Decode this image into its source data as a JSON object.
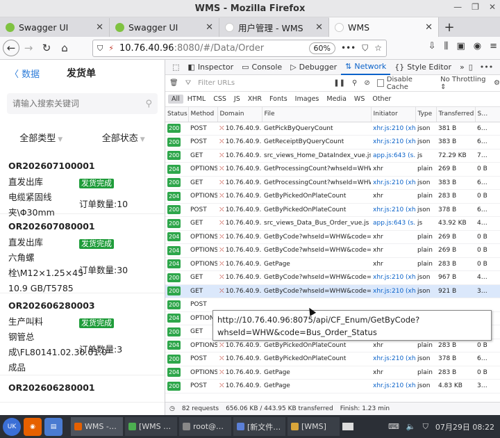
{
  "window": {
    "title": "WMS - Mozilla Firefox"
  },
  "tabs": [
    {
      "label": "Swagger UI",
      "icon_color": "#7fc241"
    },
    {
      "label": "Swagger UI",
      "icon_color": "#7fc241"
    },
    {
      "label": "用户管理 - WMS",
      "icon_color": "#ffffff"
    },
    {
      "label": "WMS",
      "icon_color": "#ffffff"
    }
  ],
  "nav": {
    "url_host": "10.76.40.96",
    "url_rest": ":8080/#/Data/Order",
    "zoom": "60%"
  },
  "page": {
    "back_label": "数据",
    "title": "发货单",
    "search_placeholder": "请输入搜索关键词",
    "filter_type": "全部类型",
    "filter_status": "全部状态",
    "orders": [
      {
        "id": "OR202607100001",
        "type": "直发出库",
        "badge": "发货完成",
        "material_1": "电缆紧固线",
        "material_2": "夹\\Φ30mm",
        "qty": "订单数量:10"
      },
      {
        "id": "OR202607080001",
        "type": "直发出库",
        "badge": "发货完成",
        "material_1": "六角螺",
        "material_2": "栓\\M12×1.25×45",
        "material_3": "10.9 GB/T5785",
        "qty": "订单数量:30"
      },
      {
        "id": "OR202606280003",
        "type": "生产叫料",
        "badge": "发货完成",
        "material_1": "钢管总",
        "material_2": "成\\FL80141.02.30.01.0",
        "material_3": "成品",
        "qty": "订单数量:3"
      },
      {
        "id": "OR202606280001"
      }
    ]
  },
  "devtools": {
    "tabs": [
      "Inspector",
      "Console",
      "Debugger",
      "Network",
      "Style Editor"
    ],
    "active_tab": "Network",
    "filter_placeholder": "Filter URLs",
    "disable_cache": "Disable Cache",
    "throttling": "No Throttling",
    "type_filters": [
      "All",
      "HTML",
      "CSS",
      "JS",
      "XHR",
      "Fonts",
      "Images",
      "Media",
      "WS",
      "Other"
    ],
    "columns": [
      "Status",
      "Method",
      "Domain",
      "File",
      "Initiator",
      "Type",
      "Transferred",
      "S…"
    ],
    "requests": [
      {
        "status": "200",
        "method": "POST",
        "domain": "10.76.40.9…",
        "file": "GetPickByQueryCount",
        "initiator": "xhr.js:210 (xhr)",
        "type": "json",
        "transferred": "381 B",
        "size": "6…"
      },
      {
        "status": "200",
        "method": "POST",
        "domain": "10.76.40.9…",
        "file": "GetReceiptByQueryCount",
        "initiator": "xhr.js:210 (xhr)",
        "type": "json",
        "transferred": "383 B",
        "size": "6…"
      },
      {
        "status": "200",
        "method": "GET",
        "domain": "10.76.40.9…",
        "file": "src_views_Home_DataIndex_vue.js",
        "initiator": "app.js:643 (s…",
        "type": "js",
        "transferred": "72.29 KB",
        "size": "7…"
      },
      {
        "status": "204",
        "method": "OPTIONS",
        "domain": "10.76.40.9…",
        "file": "GetProcessingCount?whseId=WHW",
        "initiator": "xhr",
        "type": "plain",
        "transferred": "269 B",
        "size": "0 B"
      },
      {
        "status": "200",
        "method": "GET",
        "domain": "10.76.40.9…",
        "file": "GetProcessingCount?whseId=WHW",
        "initiator": "xhr.js:210 (xhr)",
        "type": "json",
        "transferred": "383 B",
        "size": "6…"
      },
      {
        "status": "204",
        "method": "OPTIONS",
        "domain": "10.76.40.9…",
        "file": "GetByPickedOnPlateCount",
        "initiator": "xhr",
        "type": "plain",
        "transferred": "283 B",
        "size": "0 B"
      },
      {
        "status": "200",
        "method": "POST",
        "domain": "10.76.40.9…",
        "file": "GetByPickedOnPlateCount",
        "initiator": "xhr.js:210 (xhr)",
        "type": "json",
        "transferred": "378 B",
        "size": "6…"
      },
      {
        "status": "200",
        "method": "GET",
        "domain": "10.76.40.9…",
        "file": "src_views_Data_Bus_Order_vue.js",
        "initiator": "app.js:643 (s…",
        "type": "js",
        "transferred": "43.92 KB",
        "size": "4…"
      },
      {
        "status": "204",
        "method": "OPTIONS",
        "domain": "10.76.40.9…",
        "file": "GetByCode?whseId=WHW&code=Bus_…",
        "initiator": "xhr",
        "type": "plain",
        "transferred": "269 B",
        "size": "0 B"
      },
      {
        "status": "204",
        "method": "OPTIONS",
        "domain": "10.76.40.9…",
        "file": "GetByCode?whseId=WHW&code=Bus_…",
        "initiator": "xhr",
        "type": "plain",
        "transferred": "269 B",
        "size": "0 B"
      },
      {
        "status": "204",
        "method": "OPTIONS",
        "domain": "10.76.40.9…",
        "file": "GetPage",
        "initiator": "xhr",
        "type": "plain",
        "transferred": "283 B",
        "size": "0 B"
      },
      {
        "status": "200",
        "method": "GET",
        "domain": "10.76.40.9…",
        "file": "GetByCode?whseId=WHW&code=Bus_…",
        "initiator": "xhr.js:210 (xhr)",
        "type": "json",
        "transferred": "967 B",
        "size": "4…"
      },
      {
        "status": "200",
        "method": "GET",
        "domain": "10.76.40.9…",
        "file": "GetByCode?whseId=WHW&code=Bus_…",
        "initiator": "xhr.js:210 (xhr)",
        "type": "json",
        "transferred": "921 B",
        "size": "3…",
        "selected": true
      },
      {
        "status": "200",
        "method": "POST",
        "domain": "",
        "file": "",
        "initiator": "",
        "type": "",
        "transferred": "",
        "size": ""
      },
      {
        "status": "204",
        "method": "OPTIONS",
        "domain": "",
        "file": "",
        "initiator": "",
        "type": "",
        "transferred": "",
        "size": ""
      },
      {
        "status": "200",
        "method": "GET",
        "domain": "",
        "file": "",
        "initiator": "",
        "type": "",
        "transferred": "",
        "size": ""
      },
      {
        "status": "204",
        "method": "OPTIONS",
        "domain": "10.76.40.9…",
        "file": "GetByPickedOnPlateCount",
        "initiator": "xhr",
        "type": "plain",
        "transferred": "283 B",
        "size": "0 B"
      },
      {
        "status": "200",
        "method": "POST",
        "domain": "10.76.40.9…",
        "file": "GetByPickedOnPlateCount",
        "initiator": "xhr.js:210 (xhr)",
        "type": "json",
        "transferred": "378 B",
        "size": "6…"
      },
      {
        "status": "204",
        "method": "OPTIONS",
        "domain": "10.76.40.9…",
        "file": "GetPage",
        "initiator": "xhr",
        "type": "plain",
        "transferred": "283 B",
        "size": "0 B"
      },
      {
        "status": "200",
        "method": "POST",
        "domain": "10.76.40.9…",
        "file": "GetPage",
        "initiator": "xhr.js:210 (xhr)",
        "type": "json",
        "transferred": "4.83 KB",
        "size": "3…"
      }
    ],
    "tooltip": "http://10.76.40.96:8075/api/CF_Enum/GetByCode?whseId=WHW&code=Bus_Order_Status",
    "status_requests": "82 requests",
    "status_transferred": "656.06 KB / 443.95 KB transferred",
    "status_finish": "Finish: 1.23 min"
  },
  "taskbar": {
    "tasks": [
      {
        "label": "WMS -…",
        "icon_color": "#e66000"
      },
      {
        "label": "[WMS …",
        "icon_color": "#4caf50"
      },
      {
        "label": "root@…",
        "icon_color": "#888888"
      },
      {
        "label": "[新文件…",
        "icon_color": "#5b7fd6"
      },
      {
        "label": "[WMS]",
        "icon_color": "#d9a53a"
      }
    ],
    "clock": "07月29日 08:22"
  }
}
